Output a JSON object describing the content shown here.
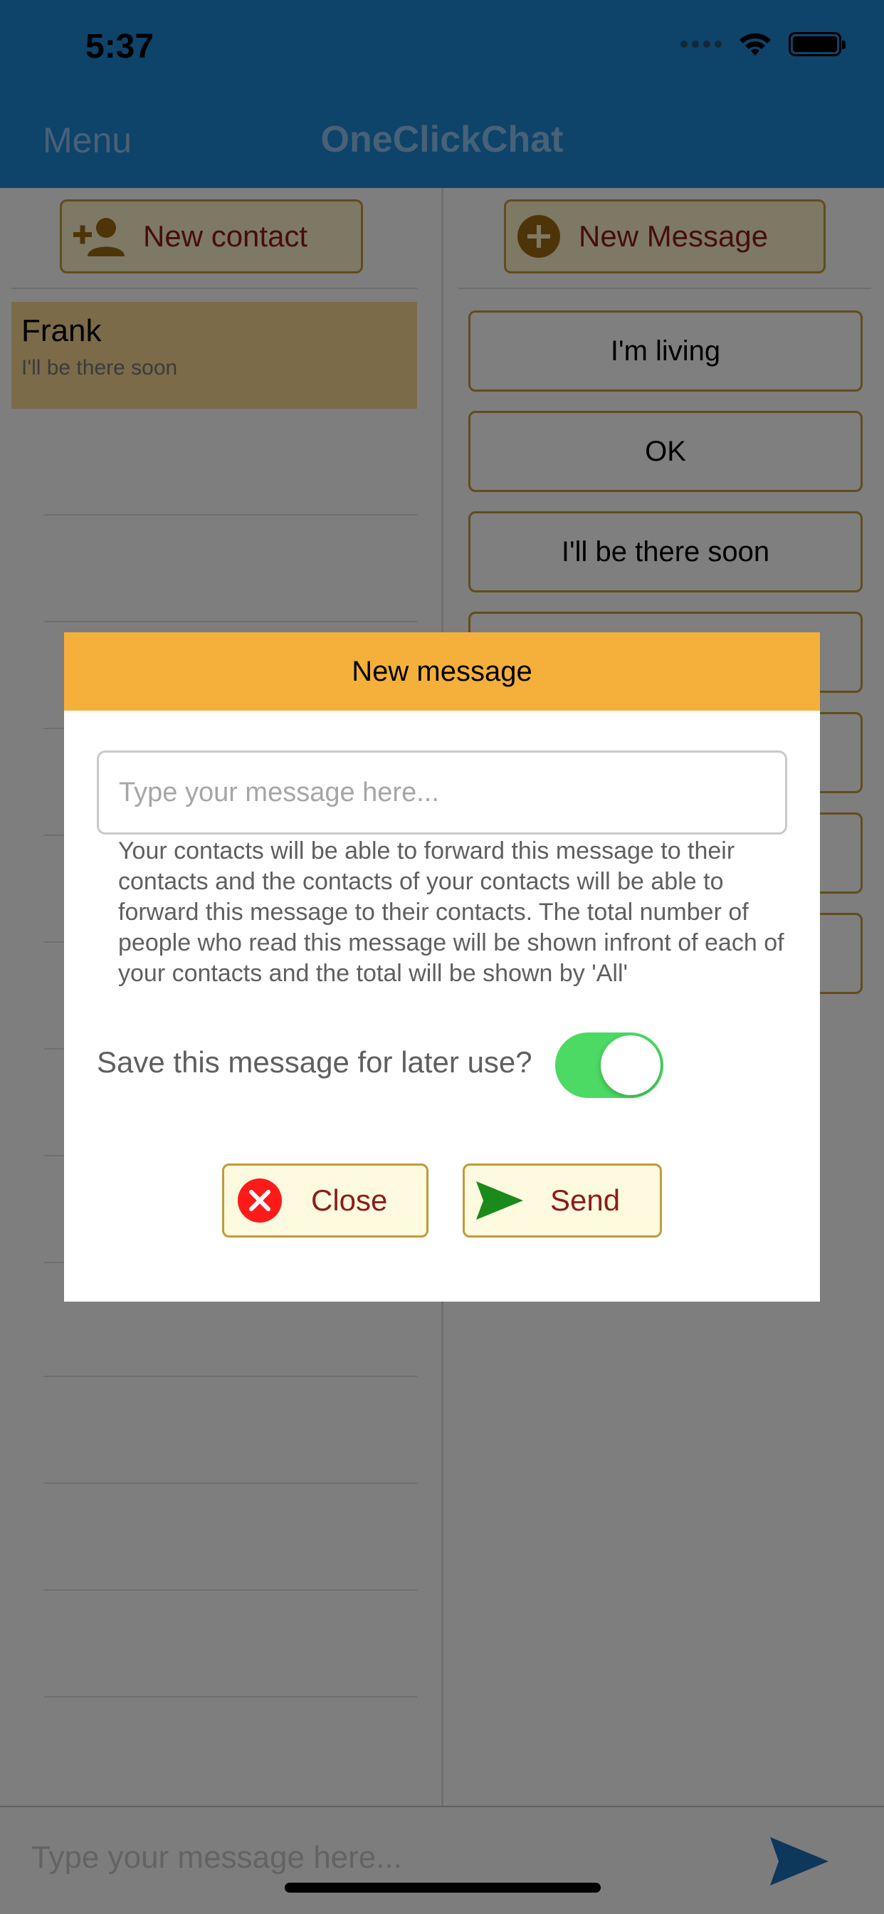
{
  "status_bar": {
    "time": "5:37"
  },
  "nav": {
    "menu": "Menu",
    "title": "OneClickChat"
  },
  "toolbar": {
    "new_contact": "New contact",
    "new_message": "New Message"
  },
  "contacts": [
    {
      "name": "Frank",
      "last_message": "I'll be there soon"
    }
  ],
  "quick_messages": [
    {
      "label": "I'm living"
    },
    {
      "label": "OK"
    },
    {
      "label": "I'll be there soon"
    },
    {
      "label": ""
    },
    {
      "label": ""
    },
    {
      "label": ""
    },
    {
      "label": ""
    }
  ],
  "bottom_bar": {
    "input_placeholder": "Type your message here..."
  },
  "modal": {
    "title": "New message",
    "input_placeholder": "Type your message here...",
    "info_text": "Your contacts will be able to forward this message to their contacts and the contacts of your contacts will be able to forward this message to their contacts. The total number of people who read this message will be shown infront of each of your contacts and the total will be shown by 'All'",
    "save_label": "Save this message for later use?",
    "save_enabled": true,
    "close_label": "Close",
    "send_label": "Send"
  },
  "colors": {
    "nav_bar": "#1c86d4",
    "modal_header": "#f4b03b",
    "button_border": "#c29a3a",
    "button_text": "#8b1c1c",
    "toggle_on": "#4cd964",
    "close_icon": "#ff1a1a",
    "send_icon": "#1a8a1a",
    "bottom_send_icon": "#1c6fb8"
  },
  "icons": {
    "new_contact": "person-add-icon",
    "new_message": "plus-circle-icon",
    "close": "close-circle-icon",
    "send": "send-icon"
  }
}
